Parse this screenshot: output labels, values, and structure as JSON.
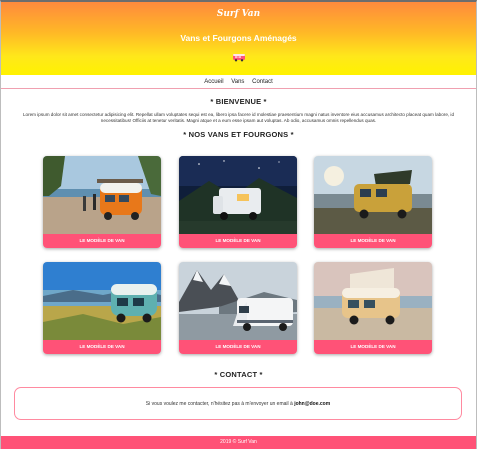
{
  "header": {
    "logo": "Surf Van",
    "title": "Vans et Fourgons Aménagés"
  },
  "nav": {
    "items": [
      {
        "label": "Accueil"
      },
      {
        "label": "Vans"
      },
      {
        "label": "Contact"
      }
    ]
  },
  "welcome": {
    "title": "* BIENVENUE *",
    "text": "Lorem ipsum dolor sit amet consectetur adipisicing elit. Repellat ullam voluptates sequi est ea, libero ipsa facere id molestiae praesentium magni natus inventore eius accusamus architecto placeat quam labore, id necessitatibus! Officiis at tenetur veritatis. Magni atque et a eum esse ipsam aut voluptas. Ab odio, accusamus omnis repellendus quas."
  },
  "vans": {
    "title": "* NOS VANS ET FOURGONS *",
    "cards": [
      {
        "button": "LE MODÈLE DE VAN"
      },
      {
        "button": "LE MODÈLE DE VAN"
      },
      {
        "button": "LE MODÈLE DE VAN"
      },
      {
        "button": "LE MODÈLE DE VAN"
      },
      {
        "button": "LE MODÈLE DE VAN"
      },
      {
        "button": "LE MODÈLE DE VAN"
      }
    ]
  },
  "contact": {
    "title": "* CONTACT *",
    "text": "Si vous voulez me contacter, n'hésitez pas à m'envoyer un email à",
    "email": "john@doe.com"
  },
  "footer": {
    "text": "2019 © Surf Van"
  },
  "colors": {
    "accent": "#ff5277",
    "gradient_top": "#ff8a3d",
    "gradient_bottom": "#fff200"
  }
}
